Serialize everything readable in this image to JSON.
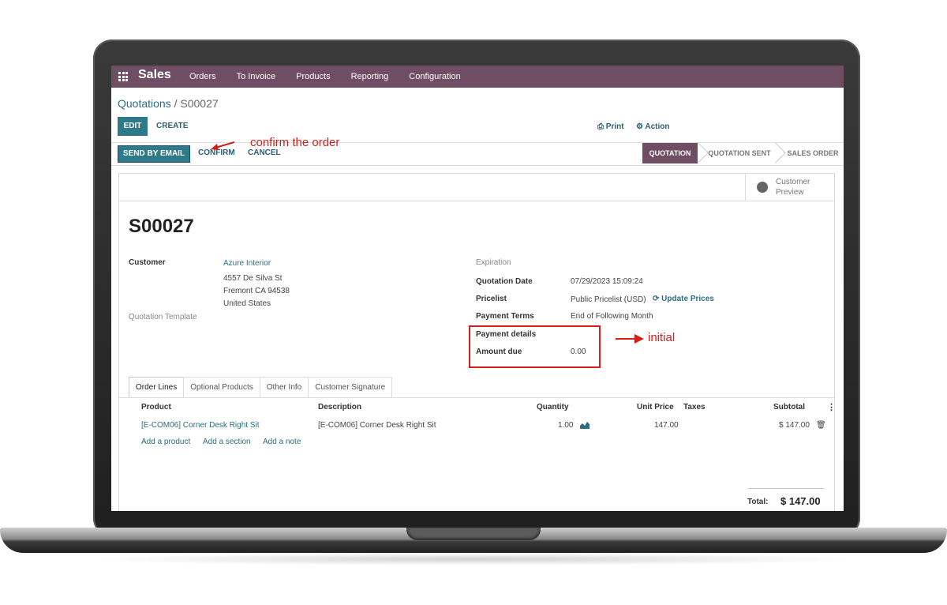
{
  "app": {
    "name": "Sales",
    "menu": [
      "Orders",
      "To Invoice",
      "Products",
      "Reporting",
      "Configuration"
    ]
  },
  "breadcrumb": {
    "parent": "Quotations",
    "separator": "/",
    "current": "S00027"
  },
  "toolbar": {
    "edit": "EDIT",
    "create": "CREATE",
    "print": "Print",
    "action": "Action"
  },
  "statusbar": {
    "send_by_email": "SEND BY EMAIL",
    "confirm": "CONFIRM",
    "cancel": "CANCEL",
    "stages": [
      "QUOTATION",
      "QUOTATION SENT",
      "SALES ORDER"
    ],
    "active_stage": "QUOTATION"
  },
  "annotations": {
    "confirm_note": "confirm the order",
    "initial_note": "initial",
    "color": "#d0201a"
  },
  "preview": {
    "label": "Customer Preview"
  },
  "order": {
    "name": "S00027",
    "customer_label": "Customer",
    "customer_name": "Azure Interior",
    "address": [
      "4557 De Silva St",
      "Fremont CA 94538",
      "United States"
    ],
    "template_label": "Quotation Template",
    "expiration_label": "Expiration",
    "quotation_date_label": "Quotation Date",
    "quotation_date": "07/29/2023 15:09:24",
    "pricelist_label": "Pricelist",
    "pricelist": "Public Pricelist (USD)",
    "update_prices": "Update Prices",
    "payment_terms_label": "Payment Terms",
    "payment_terms": "End of Following Month",
    "payment_details_label": "Payment details",
    "amount_due_label": "Amount due",
    "amount_due": "0.00"
  },
  "tabs": [
    "Order Lines",
    "Optional Products",
    "Other Info",
    "Customer Signature"
  ],
  "lines": {
    "headers": {
      "product": "Product",
      "description": "Description",
      "quantity": "Quantity",
      "unit_price": "Unit Price",
      "taxes": "Taxes",
      "subtotal": "Subtotal"
    },
    "rows": [
      {
        "product": "[E-COM06] Corner Desk Right Sit",
        "description": "[E-COM06] Corner Desk Right Sit",
        "quantity": "1.00",
        "unit_price": "147.00",
        "taxes": "",
        "subtotal": "$ 147.00"
      }
    ],
    "add_product": "Add a product",
    "add_section": "Add a section",
    "add_note": "Add a note"
  },
  "total": {
    "label": "Total:",
    "value": "$ 147.00"
  },
  "colors": {
    "brand": "#6f4d63",
    "primary_button": "#2f7a8a",
    "link": "#2c6e7e"
  }
}
